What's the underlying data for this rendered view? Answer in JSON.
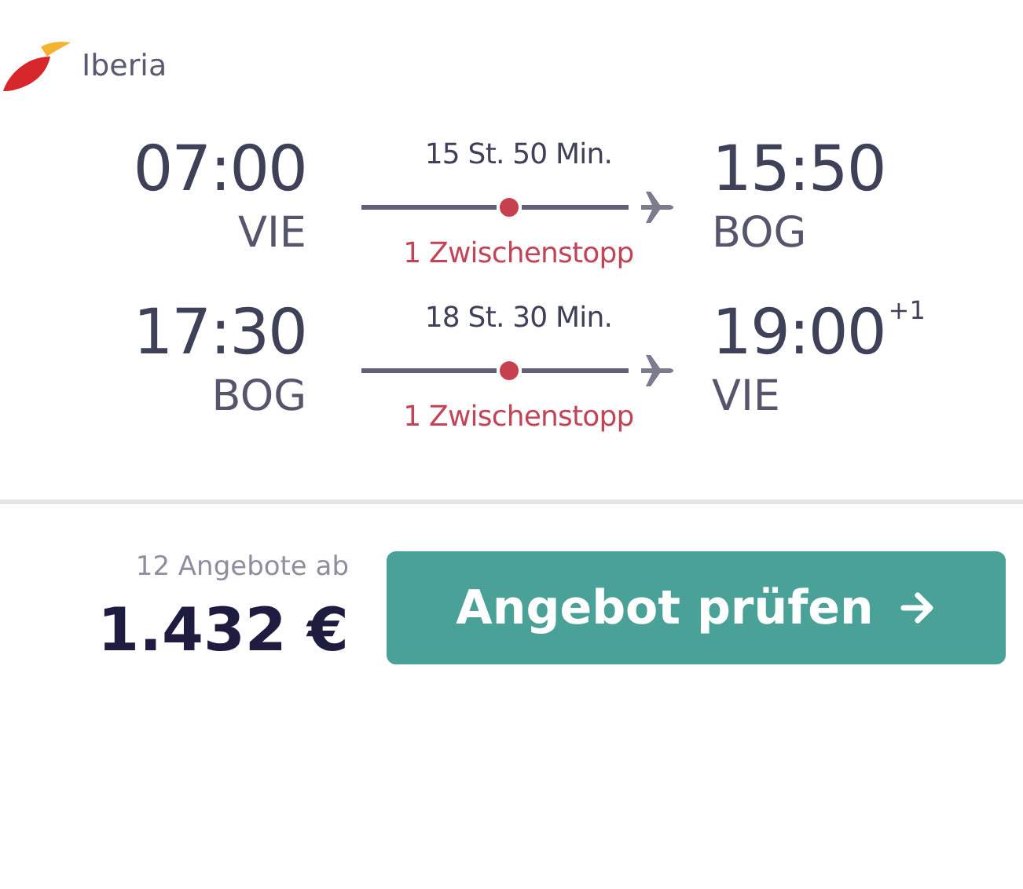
{
  "airline": {
    "name": "Iberia"
  },
  "legs": [
    {
      "depart_time": "07:00",
      "depart_code": "VIE",
      "duration": "15 St. 50 Min.",
      "stops": "1 Zwischenstopp",
      "arrive_time": "15:50",
      "arrive_code": "BOG"
    },
    {
      "depart_time": "17:30",
      "depart_code": "BOG",
      "duration": "18 St. 30 Min.",
      "stops": "1 Zwischenstopp",
      "arrive_time": "19:00",
      "day_offset": "+1",
      "arrive_code": "VIE"
    }
  ],
  "offers": "12 Angebote ab",
  "price": "1.432 €",
  "button": "Angebot prüfen"
}
